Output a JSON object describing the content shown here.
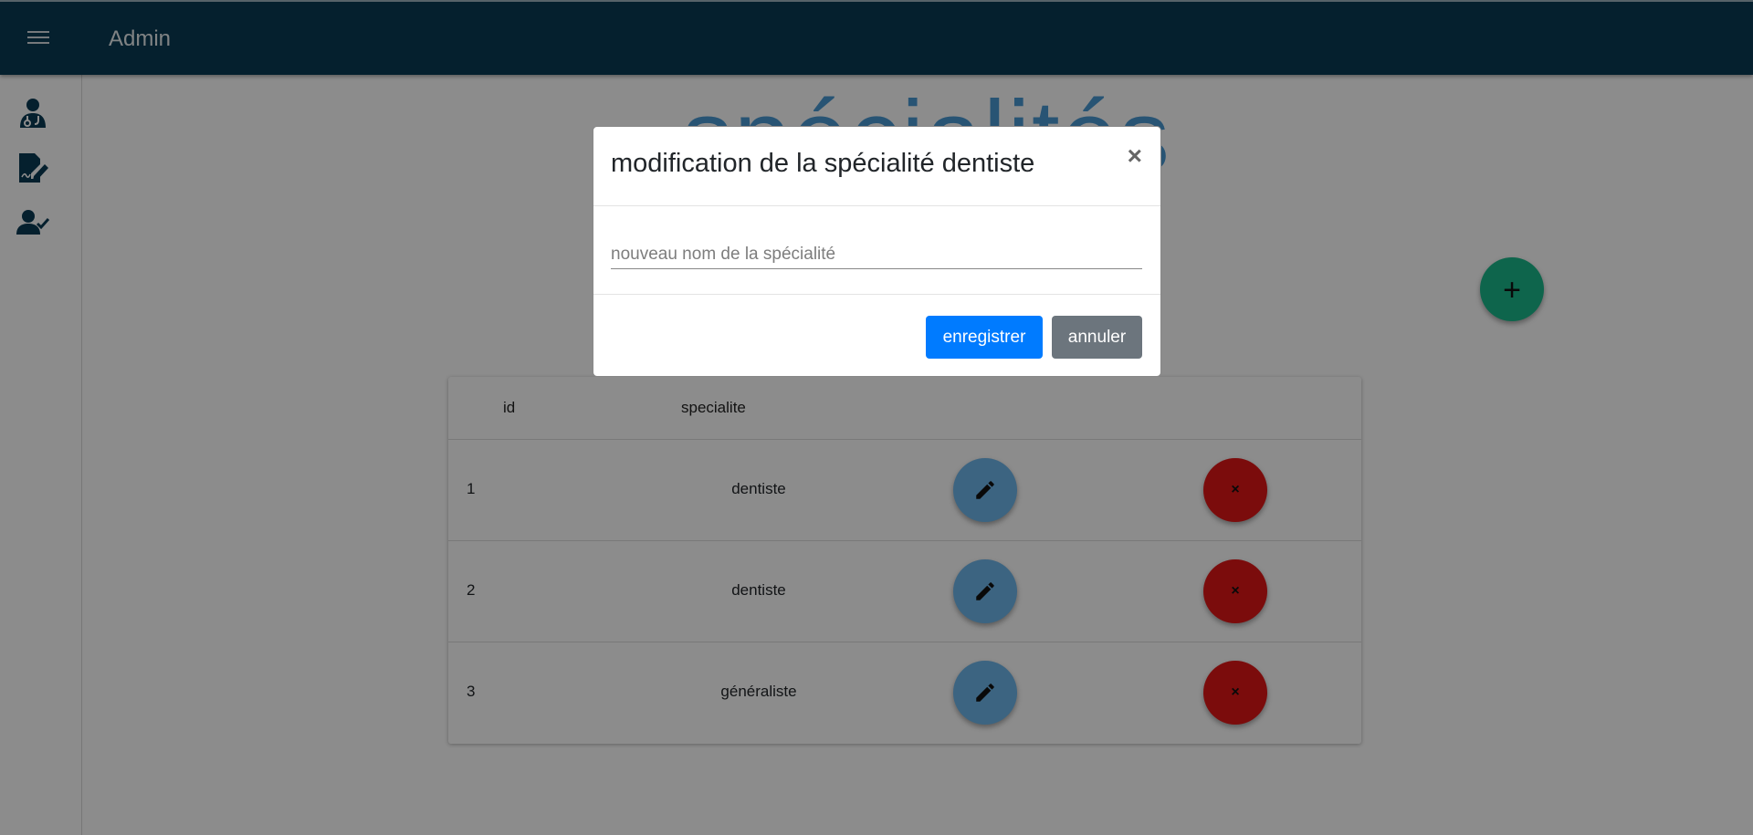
{
  "app": {
    "title": "Admin"
  },
  "page": {
    "heading": "spécialités"
  },
  "table": {
    "headers": {
      "id": "id",
      "specialite": "specialite"
    },
    "rows": [
      {
        "id": "1",
        "specialite": "dentiste"
      },
      {
        "id": "2",
        "specialite": "dentiste"
      },
      {
        "id": "3",
        "specialite": "généraliste"
      }
    ],
    "delete_symbol": "×"
  },
  "fab": {
    "add_symbol": "+"
  },
  "modal": {
    "title": "modification de la spécialité dentiste",
    "close_symbol": "×",
    "input_value": "",
    "input_placeholder": "nouveau nom de la spécialité",
    "save_label": "enregistrer",
    "cancel_label": "annuler"
  },
  "sidebar": {
    "icons": [
      "doctor-icon",
      "signed-document-icon",
      "user-check-icon"
    ]
  },
  "colors": {
    "topbar": "#0a3b55",
    "heading": "#4a9ad4",
    "fab_add": "#1ab98a",
    "edit_button": "#6db6ec",
    "delete_button": "#e11616",
    "save_button": "#007bff",
    "cancel_button": "#6c757d"
  }
}
